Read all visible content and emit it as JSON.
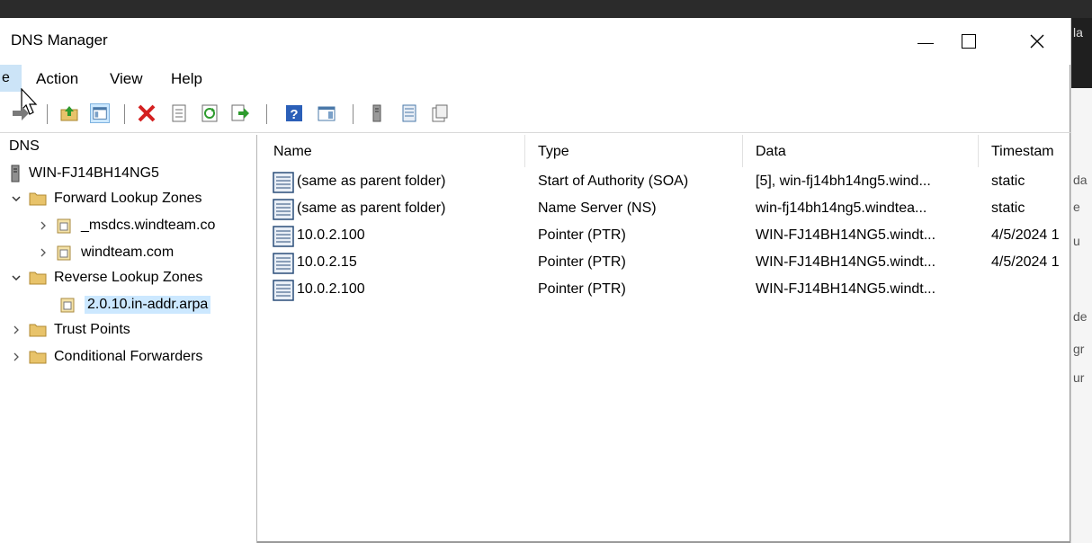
{
  "window": {
    "title": "DNS Manager"
  },
  "menu": {
    "file_partial": "e",
    "items": [
      "Action",
      "View",
      "Help"
    ]
  },
  "toolbar": {
    "icons": [
      "back-arrow-icon",
      "up-folder-icon",
      "show-hide-tree-icon",
      "delete-icon",
      "properties-icon",
      "refresh-icon",
      "export-list-icon",
      "help-icon",
      "show-action-pane-icon",
      "server-icon",
      "records-icon",
      "zone-icon"
    ]
  },
  "tree": {
    "root": "DNS",
    "server": "WIN-FJ14BH14NG5",
    "forward": "Forward Lookup Zones",
    "msdcs": "_msdcs.windteam.co",
    "windteam": "windteam.com",
    "reverse": "Reverse Lookup Zones",
    "reverse_zone": "2.0.10.in-addr.arpa",
    "trust": "Trust Points",
    "conditional": "Conditional Forwarders"
  },
  "list": {
    "columns": [
      "Name",
      "Type",
      "Data",
      "Timestam"
    ],
    "rows": [
      {
        "name": "(same as parent folder)",
        "type": "Start of Authority (SOA)",
        "data": "[5], win-fj14bh14ng5.wind...",
        "timestamp": "static"
      },
      {
        "name": "(same as parent folder)",
        "type": "Name Server (NS)",
        "data": "win-fj14bh14ng5.windtea...",
        "timestamp": "static"
      },
      {
        "name": "10.0.2.100",
        "type": "Pointer (PTR)",
        "data": "WIN-FJ14BH14NG5.windt...",
        "timestamp": "4/5/2024 1"
      },
      {
        "name": "10.0.2.15",
        "type": "Pointer (PTR)",
        "data": "WIN-FJ14BH14NG5.windt...",
        "timestamp": "4/5/2024 1"
      },
      {
        "name": "10.0.2.100",
        "type": "Pointer (PTR)",
        "data": "WIN-FJ14BH14NG5.windt...",
        "timestamp": ""
      }
    ]
  },
  "background_window": {
    "fragments": [
      "la",
      "da",
      "e",
      "u",
      "de",
      "gr",
      "ur"
    ]
  },
  "colors": {
    "selection": "#cce8ff",
    "menu_hover": "#cce4f7",
    "folder": "#e8c36a"
  }
}
